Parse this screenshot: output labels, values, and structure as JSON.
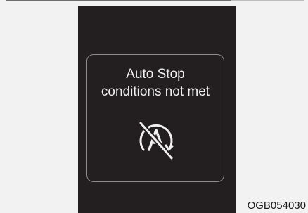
{
  "cluster_display": {
    "message_line_1": "Auto Stop",
    "message_line_2": "conditions not met",
    "icon": "auto-stop-off-icon"
  },
  "figure_code": "OGB054030",
  "colors": {
    "panel": "#231f20",
    "text": "#f0f0f0",
    "border": "#8c8c8c"
  }
}
